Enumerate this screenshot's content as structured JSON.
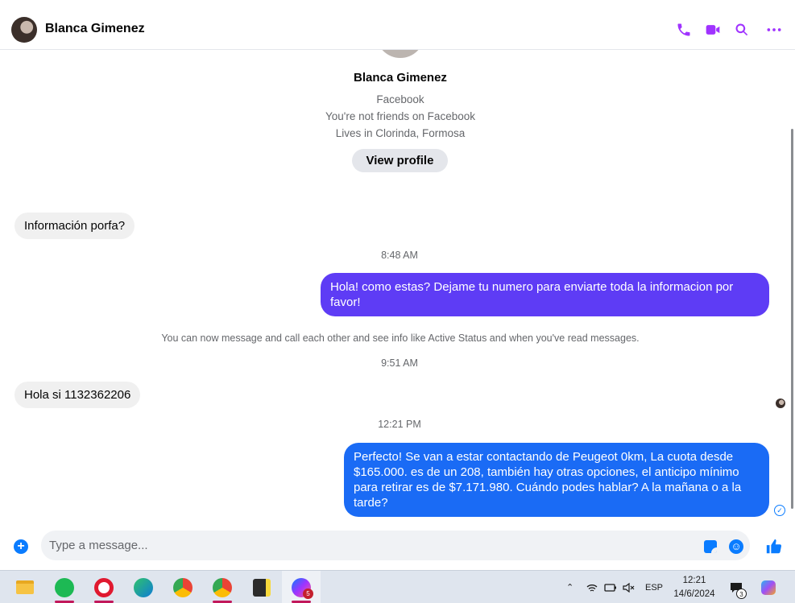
{
  "header": {
    "contact_name": "Blanca Gimenez",
    "icons": [
      "phone-icon",
      "video-call-icon",
      "search-icon",
      "more-options-icon"
    ],
    "accent_color": "#a033ff"
  },
  "profile": {
    "name": "Blanca Gimenez",
    "source": "Facebook",
    "friend_status": "You're not friends on Facebook",
    "location": "Lives in Clorinda, Formosa",
    "view_profile_label": "View profile"
  },
  "messages": [
    {
      "direction": "incoming",
      "text": "Información porfa?"
    },
    {
      "type": "timestamp",
      "text": "8:48 AM"
    },
    {
      "direction": "outgoing",
      "text": "Hola! como estas? Dejame tu numero para enviarte toda la informacion por favor!",
      "color": "#5e3cf5"
    },
    {
      "type": "notice",
      "text": "You can now message and call each other and see info like Active Status and when you've read messages."
    },
    {
      "type": "timestamp",
      "text": "9:51 AM"
    },
    {
      "direction": "incoming",
      "text": "Hola si 1132362206"
    },
    {
      "type": "timestamp",
      "text": "12:21 PM"
    },
    {
      "direction": "outgoing",
      "text": "Perfecto!  Se van a estar contactando de Peugeot 0km, La cuota desde $165.000. es de un 208, también hay otras opciones, el anticipo mínimo para retirar es de $7.171.980. Cuándo podes hablar? A la mañana o a la tarde?",
      "color": "#1a6bf5"
    }
  ],
  "composer": {
    "placeholder": "Type a message...",
    "accent_color": "#0a7cff"
  },
  "taskbar": {
    "apps": [
      "file-explorer-icon",
      "spotify-icon",
      "opera-icon",
      "edge-icon",
      "chrome-icon",
      "chrome-profile-icon",
      "sticky-notes-icon",
      "messenger-icon"
    ],
    "messenger_badge": "5",
    "language": "ESP",
    "time": "12:21",
    "date": "14/6/2024",
    "notification_count": "3"
  }
}
